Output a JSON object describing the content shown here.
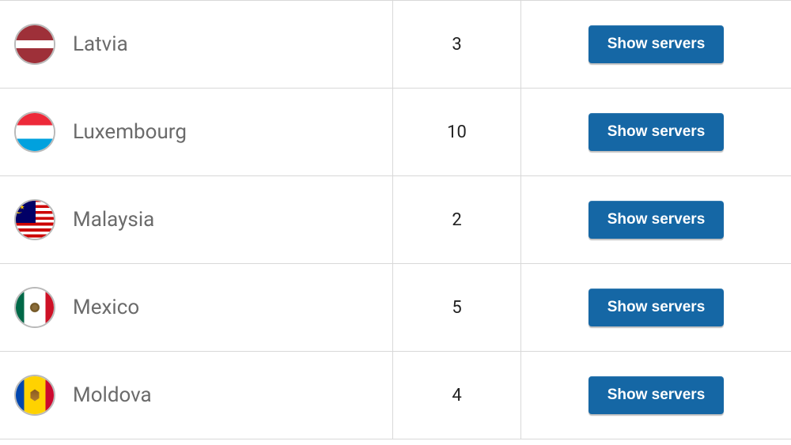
{
  "button_label": "Show servers",
  "rows": [
    {
      "country": "Latvia",
      "flag": "lv",
      "count": "3"
    },
    {
      "country": "Luxembourg",
      "flag": "lu",
      "count": "10"
    },
    {
      "country": "Malaysia",
      "flag": "my",
      "count": "2"
    },
    {
      "country": "Mexico",
      "flag": "mx",
      "count": "5"
    },
    {
      "country": "Moldova",
      "flag": "md",
      "count": "4"
    }
  ]
}
